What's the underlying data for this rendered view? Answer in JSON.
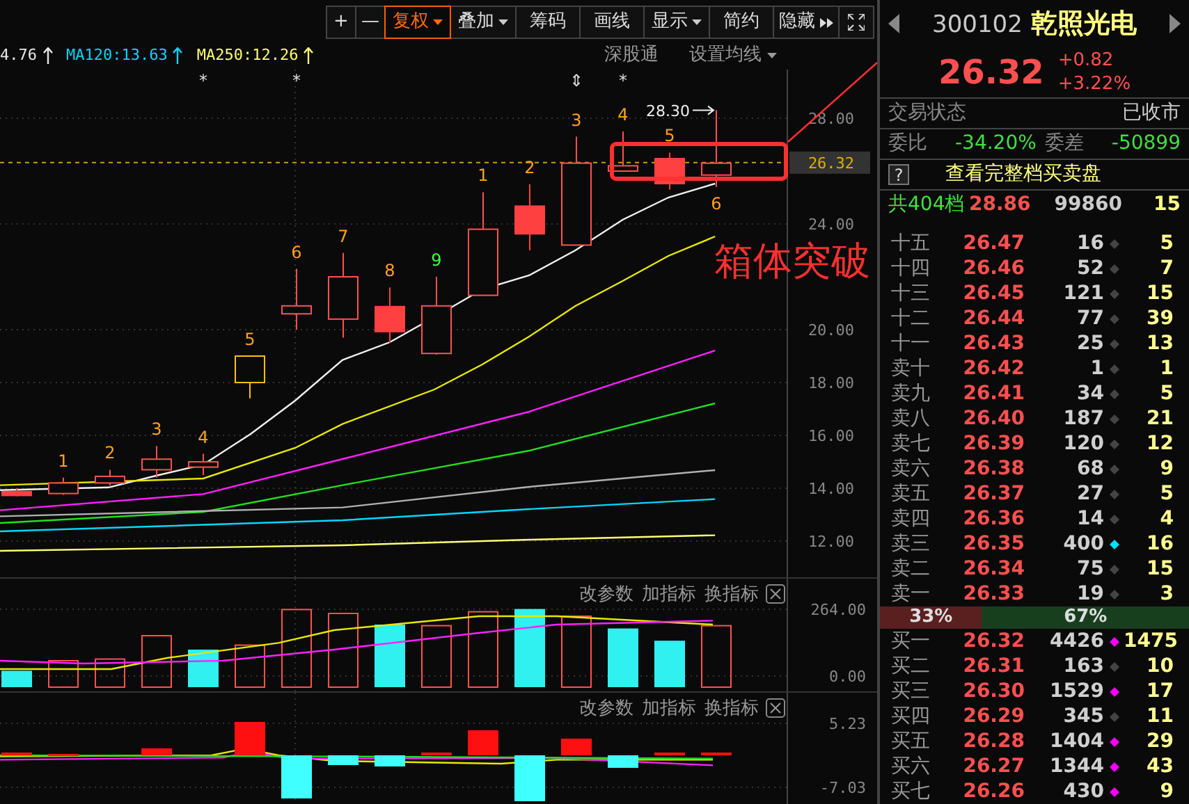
{
  "toolbar": {
    "buttons": [
      {
        "label": "+",
        "kind": "plain",
        "selected": false
      },
      {
        "label": "—",
        "kind": "plain",
        "selected": false
      },
      {
        "label": "复权",
        "kind": "dropdown",
        "selected": true
      },
      {
        "label": "叠加",
        "kind": "dropdown",
        "selected": false
      },
      {
        "label": "筹码",
        "kind": "plain",
        "selected": false
      },
      {
        "label": "画线",
        "kind": "plain",
        "selected": false
      },
      {
        "label": "显示",
        "kind": "dropdown",
        "selected": false
      },
      {
        "label": "简约",
        "kind": "plain",
        "selected": false
      },
      {
        "label": "隐藏",
        "kind": "expand",
        "selected": false
      },
      {
        "kind": "fullscreen",
        "selected": false
      }
    ]
  },
  "ma_legend": [
    {
      "text": "4.76",
      "color": "#e8e8e8"
    },
    {
      "text": "MA120:13.63",
      "color": "#00d8ff"
    },
    {
      "text": "MA250:12.26",
      "color": "#ffff70"
    }
  ],
  "chart_links": [
    {
      "label": "深股通",
      "kind": "plain"
    },
    {
      "label": "设置均线",
      "kind": "dropdown"
    }
  ],
  "price_chart": {
    "y_labels": [
      "28.00",
      "24.00",
      "20.00",
      "18.00",
      "16.00",
      "14.00",
      "12.00"
    ],
    "current_price": "26.32",
    "high_marker": "28.30",
    "annotation": "箱体突破",
    "candles": [
      {
        "kind": "filled",
        "color": "#ff4040"
      },
      {
        "kind": "hollow",
        "color": "#ff5050"
      },
      {
        "kind": "hollow",
        "color": "#ff5050"
      },
      {
        "kind": "hollow",
        "color": "#ff5050"
      },
      {
        "kind": "hollow",
        "color": "#ff5050",
        "top_mark": "*"
      },
      {
        "kind": "hollow",
        "color": "#ffc000"
      },
      {
        "kind": "hollow",
        "color": "#ff5050",
        "top_mark": "*"
      },
      {
        "kind": "hollow",
        "color": "#ff5050"
      },
      {
        "kind": "filled",
        "color": "#ff4040"
      },
      {
        "kind": "hollow",
        "color": "#ff5050"
      },
      {
        "kind": "hollow",
        "color": "#ff5050"
      },
      {
        "kind": "filled",
        "color": "#ff4040"
      },
      {
        "kind": "hollow",
        "color": "#ff5050",
        "top_mark": "⇕"
      },
      {
        "kind": "hollow",
        "color": "#ff5050",
        "top_mark": "*"
      },
      {
        "kind": "filled",
        "color": "#ff4040"
      },
      {
        "kind": "hollow",
        "color": "#ff5050"
      }
    ],
    "wave_labels": [
      {
        "text": "1",
        "color": "#ffa020"
      },
      {
        "text": "2",
        "color": "#ffa020"
      },
      {
        "text": "3",
        "color": "#ffa020"
      },
      {
        "text": "4",
        "color": "#ffa020"
      },
      {
        "text": "5",
        "color": "#ffa020"
      },
      {
        "text": "6",
        "color": "#ffa020"
      },
      {
        "text": "7",
        "color": "#ffa020"
      },
      {
        "text": "8",
        "color": "#ffa020"
      },
      {
        "text": "9",
        "color": "#40ff40"
      },
      {
        "text": "1",
        "color": "#ffa020"
      },
      {
        "text": "2",
        "color": "#ffa020"
      },
      {
        "text": "3",
        "color": "#ffa020"
      },
      {
        "text": "4",
        "color": "#ffa020"
      },
      {
        "text": "5",
        "color": "#ffa020"
      },
      {
        "text": "6",
        "color": "#ffa020"
      }
    ]
  },
  "volume_panel": {
    "actions": [
      "改参数",
      "加指标",
      "换指标"
    ],
    "y_labels": [
      "264.00",
      "0.00"
    ]
  },
  "macd_panel": {
    "actions": [
      "改参数",
      "加指标",
      "换指标"
    ],
    "y_labels": [
      "5.23",
      "-7.03"
    ]
  },
  "quote": {
    "code": "300102",
    "name": "乾照光电",
    "price": "26.32",
    "change": "+0.82",
    "change_pct": "+3.22%",
    "status_label": "交易状态",
    "status": "已收市",
    "ratio_label": "委比",
    "ratio": "-34.20%",
    "diff_label": "委差",
    "diff": "-50899",
    "help": "?",
    "full_book": "查看完整档买卖盘",
    "summary": {
      "levels": "共404档",
      "price": "28.86",
      "volume": "99860",
      "count": "15"
    }
  },
  "order_book": {
    "sell": [
      {
        "label": "十五",
        "price": "26.47",
        "volume": "16",
        "count": "5",
        "color": "#444444"
      },
      {
        "label": "十四",
        "price": "26.46",
        "volume": "52",
        "count": "7",
        "color": "#444444"
      },
      {
        "label": "十三",
        "price": "26.45",
        "volume": "121",
        "count": "15",
        "color": "#444444"
      },
      {
        "label": "十二",
        "price": "26.44",
        "volume": "77",
        "count": "39",
        "color": "#444444"
      },
      {
        "label": "十一",
        "price": "26.43",
        "volume": "25",
        "count": "13",
        "color": "#444444"
      },
      {
        "label": "卖十",
        "price": "26.42",
        "volume": "1",
        "count": "1",
        "color": "#444444"
      },
      {
        "label": "卖九",
        "price": "26.41",
        "volume": "34",
        "count": "5",
        "color": "#444444"
      },
      {
        "label": "卖八",
        "price": "26.40",
        "volume": "187",
        "count": "21",
        "color": "#444444"
      },
      {
        "label": "卖七",
        "price": "26.39",
        "volume": "120",
        "count": "12",
        "color": "#444444"
      },
      {
        "label": "卖六",
        "price": "26.38",
        "volume": "68",
        "count": "9",
        "color": "#444444"
      },
      {
        "label": "卖五",
        "price": "26.37",
        "volume": "27",
        "count": "5",
        "color": "#444444"
      },
      {
        "label": "卖四",
        "price": "26.36",
        "volume": "14",
        "count": "4",
        "color": "#444444"
      },
      {
        "label": "卖三",
        "price": "26.35",
        "volume": "400",
        "count": "16",
        "color": "#00e0ff"
      },
      {
        "label": "卖二",
        "price": "26.34",
        "volume": "75",
        "count": "15",
        "color": "#444444"
      },
      {
        "label": "卖一",
        "price": "26.33",
        "volume": "19",
        "count": "3",
        "color": "#444444"
      }
    ],
    "balance": {
      "sell_label": "33%",
      "buy_label": "67%",
      "level": 0.33
    },
    "buy": [
      {
        "label": "买一",
        "price": "26.32",
        "volume": "4426",
        "count": "1475",
        "color": "#ff00ff"
      },
      {
        "label": "买二",
        "price": "26.31",
        "volume": "163",
        "count": "10",
        "color": "#444444"
      },
      {
        "label": "买三",
        "price": "26.30",
        "volume": "1529",
        "count": "17",
        "color": "#ff00ff"
      },
      {
        "label": "买四",
        "price": "26.29",
        "volume": "345",
        "count": "11",
        "color": "#444444"
      },
      {
        "label": "买五",
        "price": "26.28",
        "volume": "1404",
        "count": "29",
        "color": "#ff00ff"
      },
      {
        "label": "买六",
        "price": "26.27",
        "volume": "1344",
        "count": "43",
        "color": "#ff00ff"
      },
      {
        "label": "买七",
        "price": "26.26",
        "volume": "430",
        "count": "9",
        "color": "#ff00ff"
      }
    ]
  }
}
